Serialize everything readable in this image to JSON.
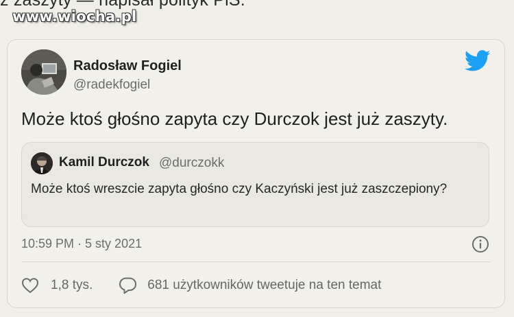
{
  "header": {
    "cropped_text": "z zaszyty — napisał polityk PiS.",
    "watermark": "www.wiocha.pl"
  },
  "tweet": {
    "author_name": "Radosław Fogiel",
    "author_handle": "@radekfogiel",
    "text": "Może ktoś głośno zapyta czy Durczok jest już zaszyty.",
    "timestamp": "10:59 PM · 5 sty 2021",
    "likes": "1,8 tys.",
    "replies_text": "681 użytkowników tweetuje na ten temat"
  },
  "quoted_tweet": {
    "author_name": "Kamil Durczok",
    "author_handle": "@durczokk",
    "text": "Może ktoś wreszcie zapyta głośno czy Kaczyński jest już zaszczepiony?"
  },
  "icons": {
    "brand": "twitter-bird-icon",
    "info": "info-icon",
    "like": "heart-icon",
    "reply": "speech-bubble-icon"
  },
  "colors": {
    "background": "#efeee7",
    "card_border": "#d5d4cd",
    "twitter_blue": "#1da1f2",
    "muted_text": "#6c6c6c"
  }
}
